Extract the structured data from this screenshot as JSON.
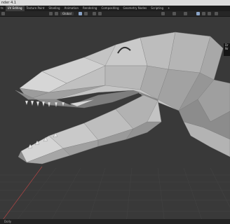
{
  "window": {
    "title": "nder 4.1"
  },
  "tabs": [
    {
      "label": "ts",
      "active": false
    },
    {
      "label": "UV Editing",
      "active": true
    },
    {
      "label": "Texture Paint",
      "active": false
    },
    {
      "label": "Shading",
      "active": false
    },
    {
      "label": "Animation",
      "active": false
    },
    {
      "label": "Rendering",
      "active": false
    },
    {
      "label": "Compositing",
      "active": false
    },
    {
      "label": "Geometry Nodes",
      "active": false
    },
    {
      "label": "Scripting",
      "active": false
    },
    {
      "label": "+",
      "active": false
    }
  ],
  "toolbar": {
    "orientation": "Global"
  },
  "nav_panel": {
    "lines": [
      "Dr",
      "Nr"
    ]
  },
  "status": {
    "text": "Dolly"
  },
  "colors": {
    "viewport_bg": "#393939",
    "mesh_light": "#c9c9c9",
    "mesh_shade": "#8e8e8e",
    "axis_red": "#b04545"
  }
}
